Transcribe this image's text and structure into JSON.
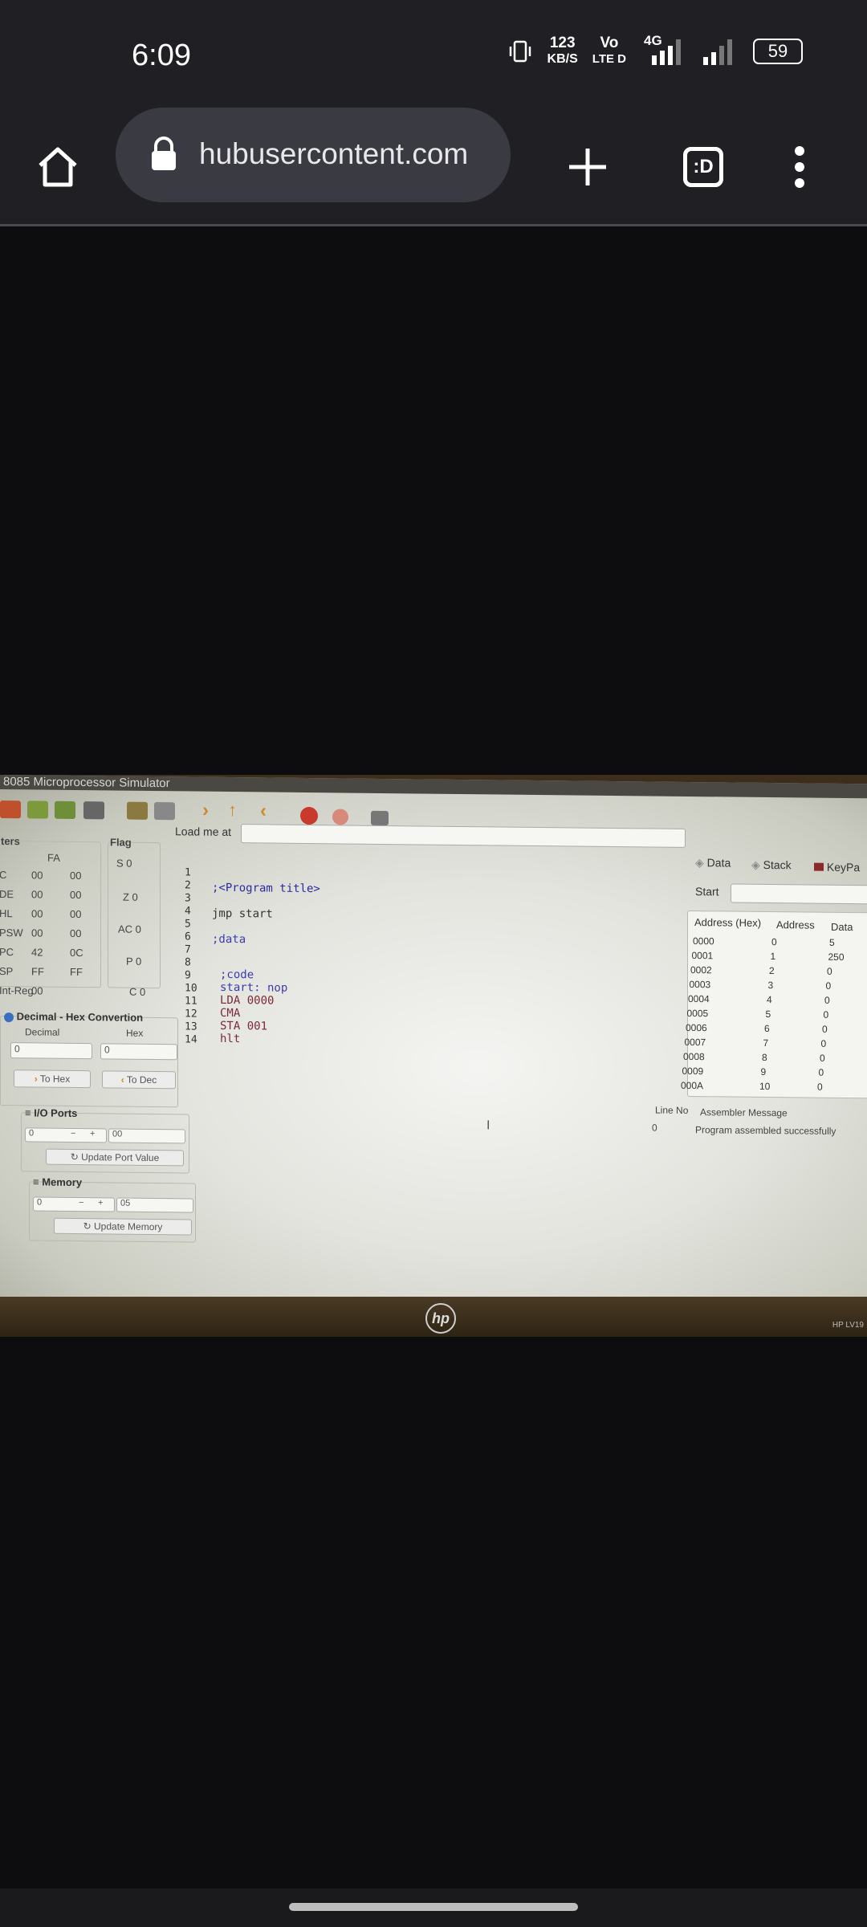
{
  "status": {
    "time": "6:09",
    "net_speed_top": "123",
    "net_speed_bottom": "KB/S",
    "volte_top": "Vo",
    "volte_bottom": "LTE D",
    "network": "4G",
    "battery": "59"
  },
  "browser": {
    "url": "hubusercontent.com",
    "tab_label": ":D"
  },
  "photo": {
    "window_title": "8085 Microprocessor Simulator",
    "registers": {
      "title": "ters",
      "col_header": "FA",
      "rows": [
        {
          "name": "C",
          "a": "00",
          "b": "00"
        },
        {
          "name": "DE",
          "a": "00",
          "b": "00"
        },
        {
          "name": "HL",
          "a": "00",
          "b": "00"
        },
        {
          "name": "PSW",
          "a": "00",
          "b": "00"
        },
        {
          "name": "PC",
          "a": "42",
          "b": "0C"
        },
        {
          "name": "SP",
          "a": "FF",
          "b": "FF"
        },
        {
          "name": "Int-Reg",
          "a": "00",
          "b": ""
        }
      ]
    },
    "flags": {
      "title": "Flag",
      "items": [
        "S 0",
        "Z 0",
        "AC 0",
        "P 0",
        "C 0"
      ]
    },
    "conversion": {
      "title": "Decimal - Hex Convertion",
      "decimal_label": "Decimal",
      "hex_label": "Hex",
      "decimal_value": "0",
      "hex_value": "0",
      "to_hex": "To Hex",
      "to_dec": "To Dec"
    },
    "io_ports": {
      "title": "I/O Ports",
      "port": "0",
      "value": "00",
      "update": "Update Port Value"
    },
    "memory": {
      "title": "Memory",
      "address": "0",
      "value": "05",
      "update": "Update Memory"
    },
    "editor": {
      "load_label": "Load me at",
      "line_numbers": [
        "1",
        "2",
        "3",
        "4",
        "5",
        "6",
        "7",
        "8",
        "9",
        "10",
        "11",
        "12",
        "13",
        "14"
      ],
      "lines": [
        {
          "line": 2,
          "text": ";<Program title>"
        },
        {
          "line": 4,
          "text": "jmp start"
        },
        {
          "line": 6,
          "text": ";data"
        },
        {
          "line": 9,
          "text": ";code"
        },
        {
          "line": 10,
          "text": "start: nop"
        },
        {
          "line": 11,
          "text": "LDA 0000"
        },
        {
          "line": 12,
          "text": "CMA"
        },
        {
          "line": 13,
          "text": "STA 001"
        },
        {
          "line": 14,
          "text": "hlt"
        }
      ]
    },
    "data_panel": {
      "tabs": [
        "Data",
        "Stack",
        "KeyPa"
      ],
      "start_label": "Start",
      "headers": [
        "Address (Hex)",
        "Address",
        "Data"
      ],
      "rows": [
        [
          "0000",
          "0",
          "5"
        ],
        [
          "0001",
          "1",
          "250"
        ],
        [
          "0002",
          "2",
          "0"
        ],
        [
          "0003",
          "3",
          "0"
        ],
        [
          "0004",
          "4",
          "0"
        ],
        [
          "0005",
          "5",
          "0"
        ],
        [
          "0006",
          "6",
          "0"
        ],
        [
          "0007",
          "7",
          "0"
        ],
        [
          "0008",
          "8",
          "0"
        ],
        [
          "0009",
          "9",
          "0"
        ],
        [
          "000A",
          "10",
          "0"
        ]
      ]
    },
    "messages": {
      "headers": [
        "Line No",
        "Assembler Message"
      ],
      "line": "0",
      "text": "Program assembled successfully"
    },
    "monitor_model": "HP LV19"
  }
}
